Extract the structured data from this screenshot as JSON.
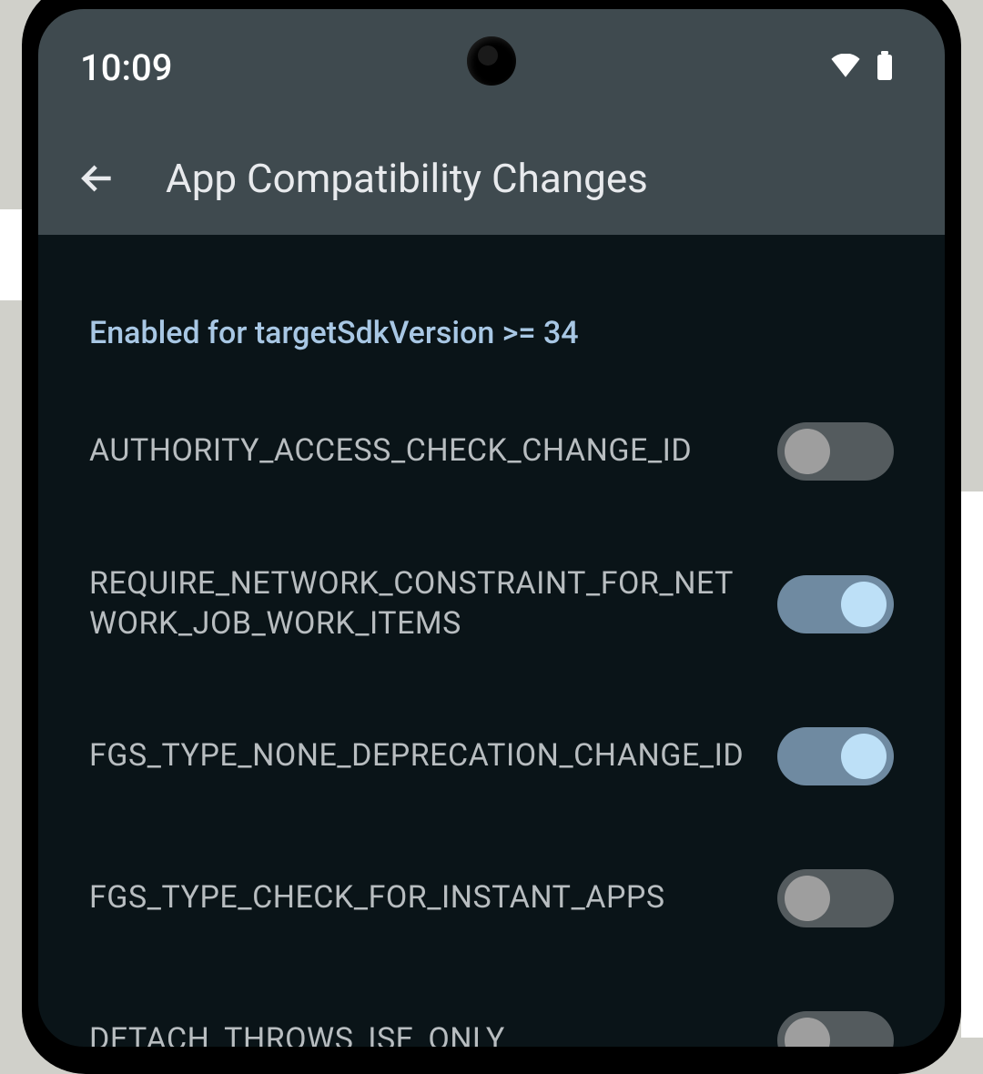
{
  "status": {
    "time": "10:09"
  },
  "header": {
    "title": "App Compatibility Changes"
  },
  "section": {
    "title": "Enabled for targetSdkVersion >= 34"
  },
  "settings": [
    {
      "label": "AUTHORITY_ACCESS_CHECK_CHANGE_ID",
      "enabled": false
    },
    {
      "label": "REQUIRE_NETWORK_CONSTRAINT_FOR_NETWORK_JOB_WORK_ITEMS",
      "enabled": true
    },
    {
      "label": "FGS_TYPE_NONE_DEPRECATION_CHANGE_ID",
      "enabled": true
    },
    {
      "label": "FGS_TYPE_CHECK_FOR_INSTANT_APPS",
      "enabled": false
    },
    {
      "label": "DETACH_THROWS_ISE_ONLY",
      "enabled": false
    }
  ]
}
